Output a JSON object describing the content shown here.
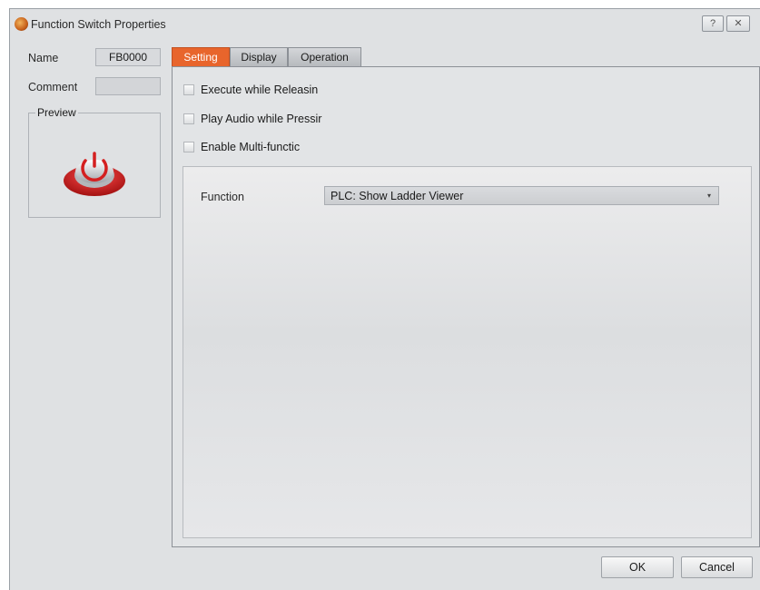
{
  "window": {
    "title": "Function Switch Properties",
    "help_label": "?",
    "close_label": "✕"
  },
  "fields": {
    "name_label": "Name",
    "name_value": "FB0000",
    "comment_label": "Comment",
    "comment_value": "",
    "preview_label": "Preview"
  },
  "tabs": [
    {
      "label": "Setting",
      "active": true
    },
    {
      "label": "Display",
      "active": false
    },
    {
      "label": "Operation",
      "active": false
    }
  ],
  "options": [
    {
      "label": "Execute while Releasin",
      "checked": false
    },
    {
      "label": "Play Audio while Pressir",
      "checked": false
    },
    {
      "label": "Enable Multi-functic",
      "checked": false
    }
  ],
  "function": {
    "label": "Function",
    "value": "PLC: Show Ladder Viewer",
    "arrow": "▾"
  },
  "buttons": {
    "ok": "OK",
    "cancel": "Cancel"
  },
  "colors": {
    "active_tab": "#e8652c",
    "button_red": "#d42020"
  },
  "icons": {
    "app": "function-switch-app-icon",
    "preview": "power-button-icon"
  }
}
